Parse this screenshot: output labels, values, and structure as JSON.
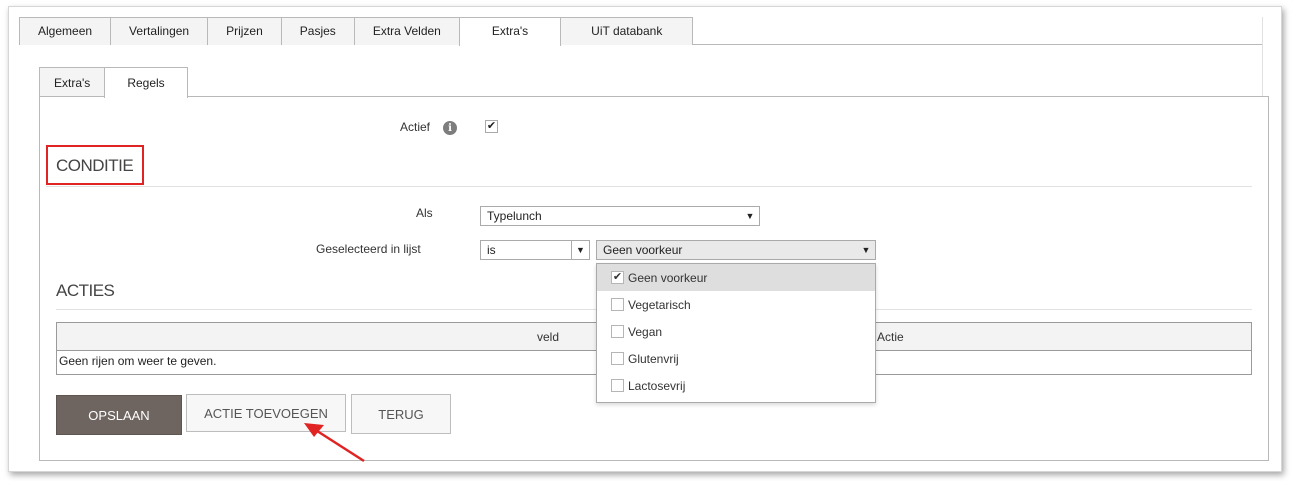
{
  "tabs_top": [
    "Algemeen",
    "Vertalingen",
    "Prijzen",
    "Pasjes",
    "Extra Velden",
    "Extra's",
    "UiT databank"
  ],
  "tabs_top_active": "Extra's",
  "tabs_inner": [
    "Extra's",
    "Regels"
  ],
  "tabs_inner_active": "Regels",
  "actief": {
    "label": "Actief",
    "checked": true,
    "check_glyph": "✔"
  },
  "conditie": {
    "title": "CONDITIE",
    "als_label": "Als",
    "als_value": "Typelunch",
    "geselecteerd_label": "Geselecteerd in lijst",
    "operator_value": "is",
    "list_value": "Geen voorkeur",
    "options": [
      {
        "label": "Geen voorkeur",
        "checked": true
      },
      {
        "label": "Vegetarisch",
        "checked": false
      },
      {
        "label": "Vegan",
        "checked": false
      },
      {
        "label": "Glutenvrij",
        "checked": false
      },
      {
        "label": "Lactosevrij",
        "checked": false
      }
    ]
  },
  "acties": {
    "title": "ACTIES",
    "col_veld": "veld",
    "col_actie": "Actie",
    "empty_text": "Geen rijen om weer te geven."
  },
  "buttons": {
    "save": "OPSLAAN",
    "add_action": "ACTIE TOEVOEGEN",
    "back": "TERUG"
  },
  "colors": {
    "highlight": "#e02424",
    "primary_button": "#6f6560",
    "arrow": "#e02424"
  },
  "icons": {
    "info": "info-icon",
    "caret": "caret-down-icon",
    "check": "check-icon",
    "arrow": "annotation-arrow-icon"
  }
}
